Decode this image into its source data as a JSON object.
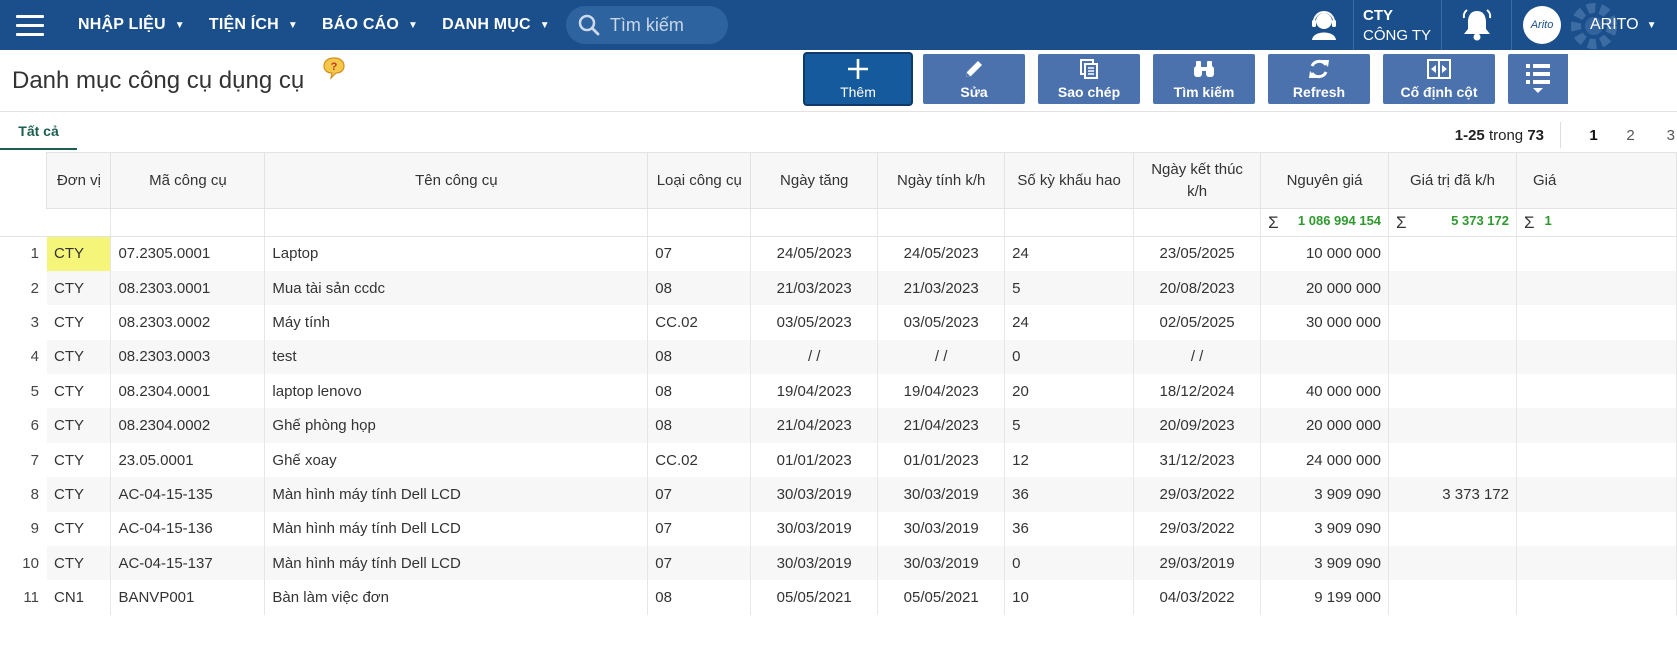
{
  "nav": {
    "items": [
      "NHẬP LIỆU",
      "TIỆN ÍCH",
      "BÁO CÁO",
      "DANH MỤC"
    ],
    "search_placeholder": "Tìm kiếm",
    "company_code": "CTY",
    "company_name": "CÔNG TY",
    "user_name": "ARITO",
    "avatar_text": "Arito"
  },
  "page": {
    "title": "Danh mục công cụ dụng cụ",
    "help_glyph": "?"
  },
  "toolbar": {
    "add": "Thêm",
    "edit": "Sửa",
    "copy": "Sao chép",
    "search": "Tìm kiếm",
    "refresh": "Refresh",
    "fix_columns": "Cố định cột"
  },
  "tabs": {
    "all": "Tất cả"
  },
  "pager": {
    "range": "1-25",
    "of_word": "trong",
    "total": "73",
    "pages": [
      "1",
      "2",
      "3"
    ]
  },
  "table": {
    "columns": [
      "Đơn vị",
      "Mã công cụ",
      "Tên công cụ",
      "Loại công cụ",
      "Ngày tăng",
      "Ngày tính k/h",
      "Số kỳ khấu hao",
      "Ngày kết thúc k/h",
      "Nguyên giá",
      "Giá trị đã k/h",
      "Giá"
    ],
    "sum_symbol": "Σ",
    "sums": {
      "nguyen_gia": "1 086 994 154",
      "da_kh": "5 373 172",
      "gia": "1"
    },
    "rows": [
      {
        "no": "1",
        "dv": "CTY",
        "ma": "07.2305.0001",
        "ten": "Laptop",
        "loai": "07",
        "ngay_tang": "24/05/2023",
        "ngay_kh": "24/05/2023",
        "so_ky": "24",
        "ngay_kt": "23/05/2025",
        "nguyen_gia": "10 000 000",
        "da_kh": ""
      },
      {
        "no": "2",
        "dv": "CTY",
        "ma": "08.2303.0001",
        "ten": "Mua tài sản ccdc",
        "loai": "08",
        "ngay_tang": "21/03/2023",
        "ngay_kh": "21/03/2023",
        "so_ky": "5",
        "ngay_kt": "20/08/2023",
        "nguyen_gia": "20 000 000",
        "da_kh": ""
      },
      {
        "no": "3",
        "dv": "CTY",
        "ma": "08.2303.0002",
        "ten": "Máy tính",
        "loai": "CC.02",
        "ngay_tang": "03/05/2023",
        "ngay_kh": "03/05/2023",
        "so_ky": "24",
        "ngay_kt": "02/05/2025",
        "nguyen_gia": "30 000 000",
        "da_kh": ""
      },
      {
        "no": "4",
        "dv": "CTY",
        "ma": "08.2303.0003",
        "ten": "test",
        "loai": "08",
        "ngay_tang": "/ /",
        "ngay_kh": "/ /",
        "so_ky": "0",
        "ngay_kt": "/ /",
        "nguyen_gia": "",
        "da_kh": ""
      },
      {
        "no": "5",
        "dv": "CTY",
        "ma": "08.2304.0001",
        "ten": "laptop lenovo",
        "loai": "08",
        "ngay_tang": "19/04/2023",
        "ngay_kh": "19/04/2023",
        "so_ky": "20",
        "ngay_kt": "18/12/2024",
        "nguyen_gia": "40 000 000",
        "da_kh": ""
      },
      {
        "no": "6",
        "dv": "CTY",
        "ma": "08.2304.0002",
        "ten": "Ghế phòng họp",
        "loai": "08",
        "ngay_tang": "21/04/2023",
        "ngay_kh": "21/04/2023",
        "so_ky": "5",
        "ngay_kt": "20/09/2023",
        "nguyen_gia": "20 000 000",
        "da_kh": ""
      },
      {
        "no": "7",
        "dv": "CTY",
        "ma": "23.05.0001",
        "ten": "Ghế xoay",
        "loai": "CC.02",
        "ngay_tang": "01/01/2023",
        "ngay_kh": "01/01/2023",
        "so_ky": "12",
        "ngay_kt": "31/12/2023",
        "nguyen_gia": "24 000 000",
        "da_kh": ""
      },
      {
        "no": "8",
        "dv": "CTY",
        "ma": "AC-04-15-135",
        "ten": "Màn hình máy tính Dell LCD",
        "loai": "07",
        "ngay_tang": "30/03/2019",
        "ngay_kh": "30/03/2019",
        "so_ky": "36",
        "ngay_kt": "29/03/2022",
        "nguyen_gia": "3 909 090",
        "da_kh": "3 373 172"
      },
      {
        "no": "9",
        "dv": "CTY",
        "ma": "AC-04-15-136",
        "ten": "Màn hình máy tính Dell LCD",
        "loai": "07",
        "ngay_tang": "30/03/2019",
        "ngay_kh": "30/03/2019",
        "so_ky": "36",
        "ngay_kt": "29/03/2022",
        "nguyen_gia": "3 909 090",
        "da_kh": ""
      },
      {
        "no": "10",
        "dv": "CTY",
        "ma": "AC-04-15-137",
        "ten": "Màn hình máy tính Dell LCD",
        "loai": "07",
        "ngay_tang": "30/03/2019",
        "ngay_kh": "30/03/2019",
        "so_ky": "0",
        "ngay_kt": "29/03/2019",
        "nguyen_gia": "3 909 090",
        "da_kh": ""
      },
      {
        "no": "11",
        "dv": "CN1",
        "ma": "BANVP001",
        "ten": "Bàn làm việc đơn",
        "loai": "08",
        "ngay_tang": "05/05/2021",
        "ngay_kh": "05/05/2021",
        "so_ky": "10",
        "ngay_kt": "04/03/2022",
        "nguyen_gia": "9 199 000",
        "da_kh": ""
      }
    ]
  },
  "colors": {
    "nav_bg": "#1a4f8c",
    "button_bg": "#4c72ad",
    "primary_button_bg": "#155a9c",
    "sum_green": "#2e9a2e",
    "highlight_yellow": "#f5f57a"
  }
}
